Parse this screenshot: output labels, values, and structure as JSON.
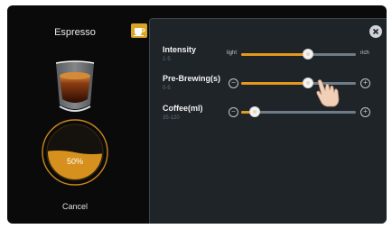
{
  "drink": {
    "name": "Espresso"
  },
  "progress": {
    "percent_label": "50%",
    "value": 0.5
  },
  "actions": {
    "cancel_label": "Cancel"
  },
  "settings": {
    "intensity": {
      "label": "Intensity",
      "range": "1-5",
      "min_label": "light",
      "max_label": "rich",
      "value": 0.58
    },
    "pre_brewing": {
      "label": "Pre-Brewing(s)",
      "range": "0-5",
      "value": 0.58
    },
    "coffee": {
      "label": "Coffee(ml)",
      "range": "35-120",
      "value": 0.12
    }
  },
  "colors": {
    "accent": "#e39a1c",
    "panel": "#1f2429",
    "track": "#6f7c88",
    "tab_icon": "#d8a526"
  },
  "icons": [
    "espresso-cup-icon",
    "cup-tab-icon",
    "close-icon",
    "minus-icon",
    "plus-icon",
    "hand-cursor-icon"
  ]
}
